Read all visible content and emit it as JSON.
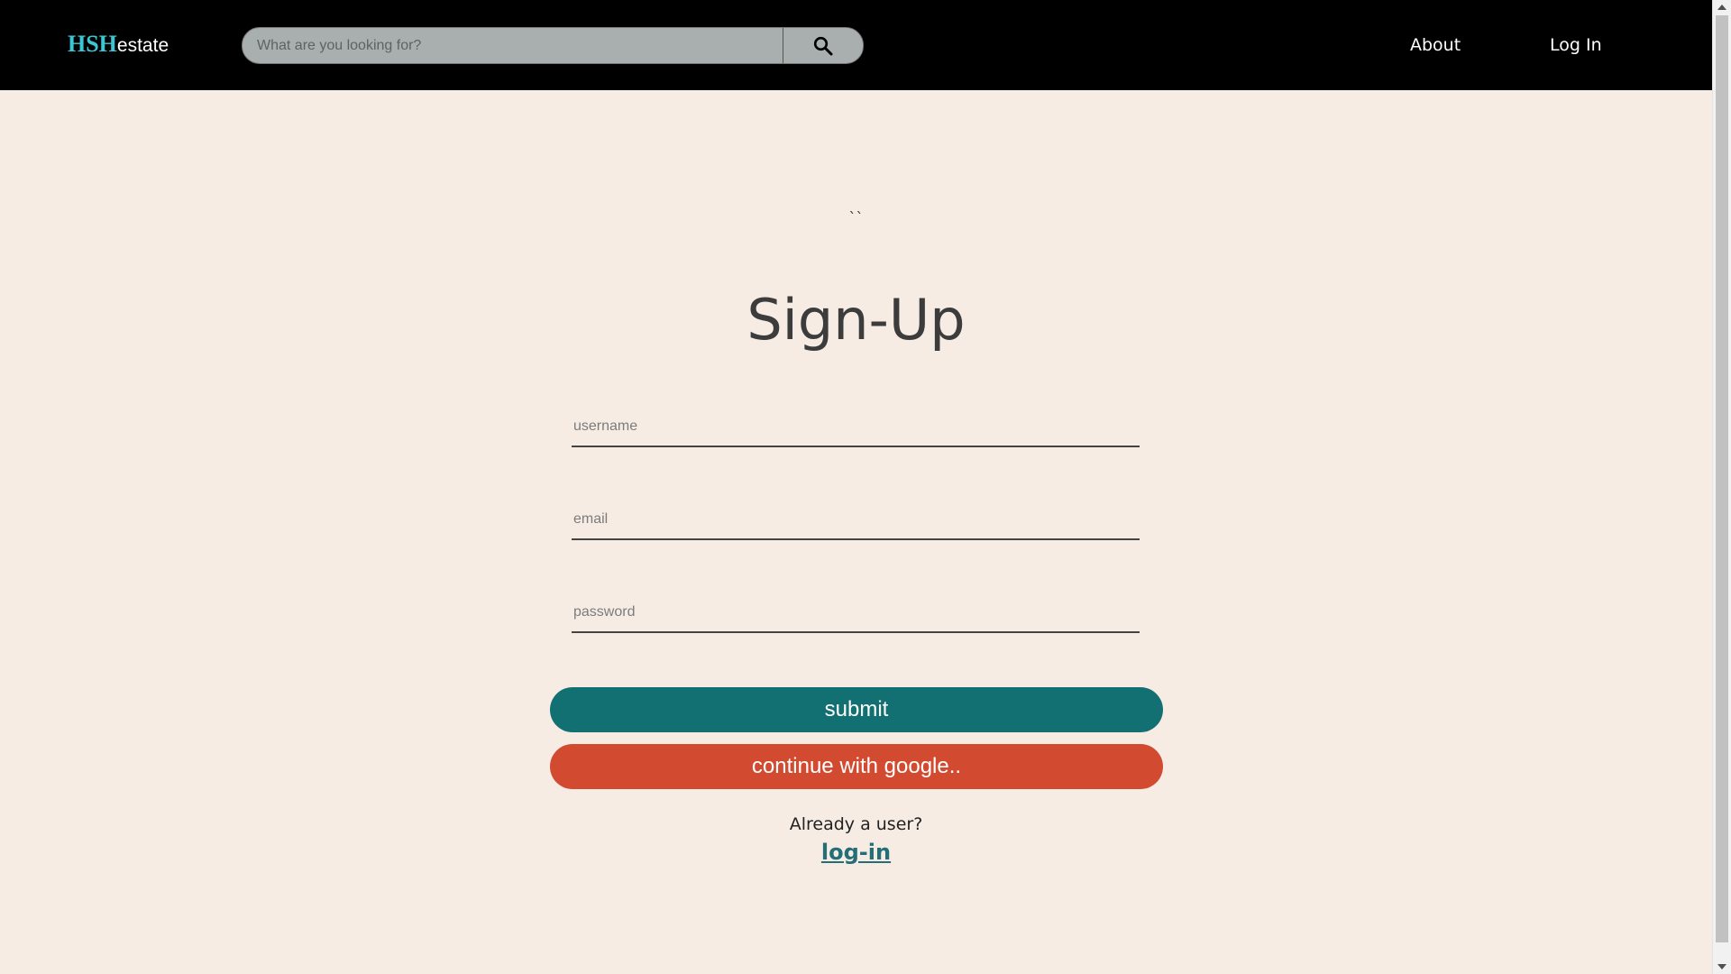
{
  "header": {
    "logo_brand": "HSH",
    "logo_suffix": "estate",
    "search": {
      "placeholder": "What are you looking for?",
      "value": "",
      "button_icon": "search-icon"
    },
    "nav": {
      "about": "About",
      "login": "Log In"
    }
  },
  "main": {
    "backticks": "``",
    "title": "Sign-Up",
    "fields": {
      "username_placeholder": "username",
      "email_placeholder": "email",
      "password_placeholder": "password"
    },
    "submit_label": "submit",
    "google_label": "continue with google..",
    "already_text": "Already a user?",
    "login_link": "log-in"
  },
  "colors": {
    "background": "#f6ece4",
    "topbar": "#000000",
    "brand": "#3cc6d4",
    "submit": "#126f72",
    "google": "#d24b31",
    "link": "#246e78"
  }
}
